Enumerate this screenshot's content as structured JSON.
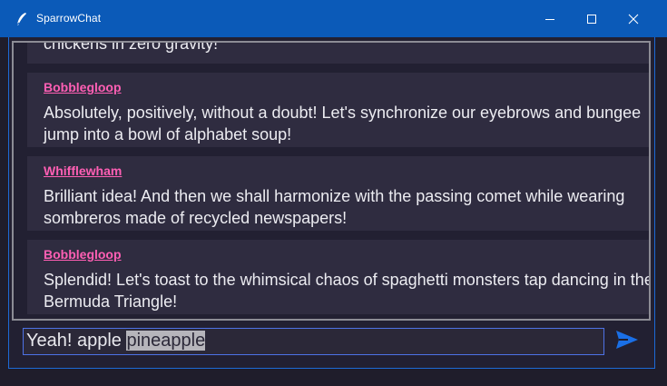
{
  "window": {
    "title": "SparrowChat"
  },
  "titlebar": {
    "minimize_icon": "minimize-icon",
    "maximize_icon": "maximize-icon",
    "close_icon": "close-icon"
  },
  "messages": [
    {
      "author": "",
      "text": "chickens in zero gravity!"
    },
    {
      "author": "Bobblegloop",
      "text": "Absolutely, positively, without a doubt! Let's synchronize our eyebrows and bungee jump into a bowl of alphabet soup!"
    },
    {
      "author": "Whifflewham",
      "text": "Brilliant idea! And then we shall harmonize with the passing comet while wearing sombreros made of recycled newspapers!"
    },
    {
      "author": "Bobblegloop",
      "text": "Splendid! Let's toast to the whimsical chaos of spaghetti monsters tap dancing in the Bermuda Triangle!"
    }
  ],
  "composer": {
    "value_plain": "Yeah! apple ",
    "value_selected": "pineapple",
    "send_icon": "send-icon"
  },
  "colors": {
    "titlebar": "#0b5ab8",
    "author": "#ff5fb4",
    "message_bg": "#2f2c40",
    "send": "#1a6fe6"
  }
}
